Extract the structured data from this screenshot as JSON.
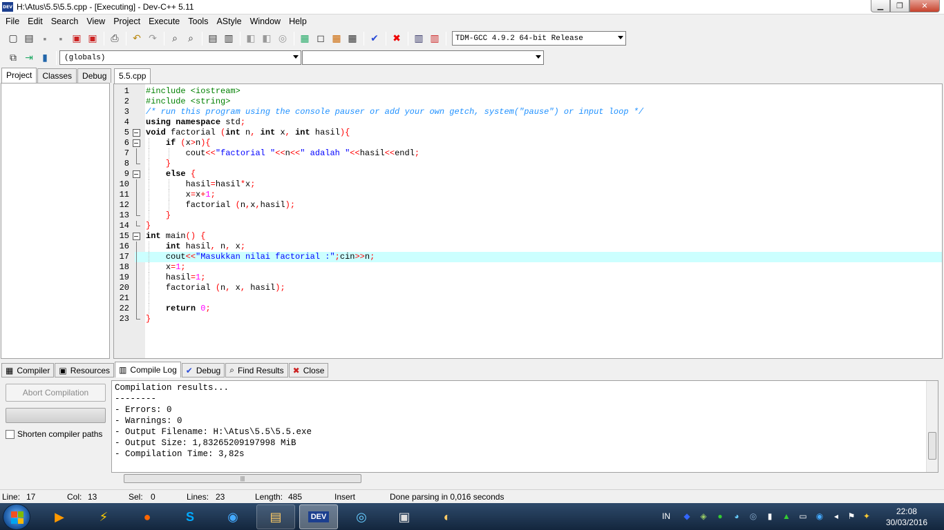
{
  "window": {
    "title": "H:\\Atus\\5.5\\5.5.cpp - [Executing] - Dev-C++ 5.11",
    "app_icon_label": "DEV",
    "controls": {
      "minimize": "▁",
      "maximize": "❐",
      "close": "✕"
    }
  },
  "menu": [
    "File",
    "Edit",
    "Search",
    "View",
    "Project",
    "Execute",
    "Tools",
    "AStyle",
    "Window",
    "Help"
  ],
  "toolbar": {
    "compiler": "TDM-GCC 4.9.2 64-bit Release",
    "scope": "(globals)",
    "function": ""
  },
  "left_tabs": [
    "Project",
    "Classes",
    "Debug"
  ],
  "editor": {
    "tab": "5.5.cpp",
    "current_line": 17,
    "lines": [
      {
        "n": "1",
        "fold": "none",
        "indent": 0,
        "tokens": [
          [
            "pre",
            "#include <iostream>"
          ]
        ]
      },
      {
        "n": "2",
        "fold": "none",
        "indent": 0,
        "tokens": [
          [
            "pre",
            "#include <string>"
          ]
        ]
      },
      {
        "n": "3",
        "fold": "none",
        "indent": 0,
        "tokens": [
          [
            "com",
            "/* run this program using the console pauser or add your own getch, system(\"pause\") or input loop */"
          ]
        ]
      },
      {
        "n": "4",
        "fold": "none",
        "indent": 0,
        "tokens": [
          [
            "kw",
            "using namespace"
          ],
          [
            "id",
            " std"
          ],
          [
            "sym",
            ";"
          ]
        ]
      },
      {
        "n": "5",
        "fold": "box",
        "indent": 0,
        "tokens": [
          [
            "kw",
            "void"
          ],
          [
            "id",
            " factorial "
          ],
          [
            "sym",
            "("
          ],
          [
            "kw",
            "int"
          ],
          [
            "id",
            " n"
          ],
          [
            "sym",
            ", "
          ],
          [
            "kw",
            "int"
          ],
          [
            "id",
            " x"
          ],
          [
            "sym",
            ", "
          ],
          [
            "kw",
            "int"
          ],
          [
            "id",
            " hasil"
          ],
          [
            "sym",
            "){"
          ]
        ]
      },
      {
        "n": "6",
        "fold": "box",
        "indent": 1,
        "tokens": [
          [
            "kw",
            "if"
          ],
          [
            "id",
            " "
          ],
          [
            "sym",
            "("
          ],
          [
            "id",
            "x"
          ],
          [
            "sym",
            ">"
          ],
          [
            "id",
            "n"
          ],
          [
            "sym",
            "){"
          ]
        ]
      },
      {
        "n": "7",
        "fold": "line",
        "indent": 2,
        "tokens": [
          [
            "id",
            "cout"
          ],
          [
            "sym",
            "<<"
          ],
          [
            "str",
            "\"factorial \""
          ],
          [
            "sym",
            "<<"
          ],
          [
            "id",
            "n"
          ],
          [
            "sym",
            "<<"
          ],
          [
            "str",
            "\" adalah \""
          ],
          [
            "sym",
            "<<"
          ],
          [
            "id",
            "hasil"
          ],
          [
            "sym",
            "<<"
          ],
          [
            "id",
            "endl"
          ],
          [
            "sym",
            ";"
          ]
        ]
      },
      {
        "n": "8",
        "fold": "end",
        "indent": 1,
        "tokens": [
          [
            "sym",
            "}"
          ]
        ]
      },
      {
        "n": "9",
        "fold": "box",
        "indent": 1,
        "tokens": [
          [
            "kw",
            "else"
          ],
          [
            "id",
            " "
          ],
          [
            "sym",
            "{"
          ]
        ]
      },
      {
        "n": "10",
        "fold": "line",
        "indent": 2,
        "tokens": [
          [
            "id",
            "hasil"
          ],
          [
            "sym",
            "="
          ],
          [
            "id",
            "hasil"
          ],
          [
            "sym",
            "*"
          ],
          [
            "id",
            "x"
          ],
          [
            "sym",
            ";"
          ]
        ]
      },
      {
        "n": "11",
        "fold": "line",
        "indent": 2,
        "tokens": [
          [
            "id",
            "x"
          ],
          [
            "sym",
            "="
          ],
          [
            "id",
            "x"
          ],
          [
            "sym",
            "+"
          ],
          [
            "num",
            "1"
          ],
          [
            "sym",
            ";"
          ]
        ]
      },
      {
        "n": "12",
        "fold": "line",
        "indent": 2,
        "tokens": [
          [
            "id",
            "factorial "
          ],
          [
            "sym",
            "("
          ],
          [
            "id",
            "n"
          ],
          [
            "sym",
            ","
          ],
          [
            "id",
            "x"
          ],
          [
            "sym",
            ","
          ],
          [
            "id",
            "hasil"
          ],
          [
            "sym",
            ");"
          ]
        ]
      },
      {
        "n": "13",
        "fold": "end",
        "indent": 1,
        "tokens": [
          [
            "sym",
            "}"
          ]
        ]
      },
      {
        "n": "14",
        "fold": "end",
        "indent": 0,
        "tokens": [
          [
            "sym",
            "}"
          ]
        ]
      },
      {
        "n": "15",
        "fold": "box",
        "indent": 0,
        "tokens": [
          [
            "kw",
            "int"
          ],
          [
            "id",
            " main"
          ],
          [
            "sym",
            "() {"
          ]
        ]
      },
      {
        "n": "16",
        "fold": "line",
        "indent": 1,
        "tokens": [
          [
            "kw",
            "int"
          ],
          [
            "id",
            " hasil"
          ],
          [
            "sym",
            ", "
          ],
          [
            "id",
            "n"
          ],
          [
            "sym",
            ", "
          ],
          [
            "id",
            "x"
          ],
          [
            "sym",
            ";"
          ]
        ]
      },
      {
        "n": "17",
        "fold": "line",
        "indent": 1,
        "tokens": [
          [
            "id",
            "cout"
          ],
          [
            "sym",
            "<<"
          ],
          [
            "str",
            "\"Masukkan nilai factorial :\""
          ],
          [
            "sym",
            ";"
          ],
          [
            "id",
            "cin"
          ],
          [
            "sym",
            ">>"
          ],
          [
            "id",
            "n"
          ],
          [
            "sym",
            ";"
          ]
        ]
      },
      {
        "n": "18",
        "fold": "line",
        "indent": 1,
        "tokens": [
          [
            "id",
            "x"
          ],
          [
            "sym",
            "="
          ],
          [
            "num",
            "1"
          ],
          [
            "sym",
            ";"
          ]
        ]
      },
      {
        "n": "19",
        "fold": "line",
        "indent": 1,
        "tokens": [
          [
            "id",
            "hasil"
          ],
          [
            "sym",
            "="
          ],
          [
            "num",
            "1"
          ],
          [
            "sym",
            ";"
          ]
        ]
      },
      {
        "n": "20",
        "fold": "line",
        "indent": 1,
        "tokens": [
          [
            "id",
            "factorial "
          ],
          [
            "sym",
            "("
          ],
          [
            "id",
            "n"
          ],
          [
            "sym",
            ", "
          ],
          [
            "id",
            "x"
          ],
          [
            "sym",
            ", "
          ],
          [
            "id",
            "hasil"
          ],
          [
            "sym",
            ");"
          ]
        ]
      },
      {
        "n": "21",
        "fold": "line",
        "indent": 1,
        "tokens": []
      },
      {
        "n": "22",
        "fold": "line",
        "indent": 1,
        "tokens": [
          [
            "kw",
            "return"
          ],
          [
            "id",
            " "
          ],
          [
            "num",
            "0"
          ],
          [
            "sym",
            ";"
          ]
        ]
      },
      {
        "n": "23",
        "fold": "end",
        "indent": 0,
        "tokens": [
          [
            "sym",
            "}"
          ]
        ]
      }
    ]
  },
  "bottom_tabs": [
    {
      "label": "Compiler",
      "icon": "grid-icon",
      "glyph": "▦"
    },
    {
      "label": "Resources",
      "icon": "resources-icon",
      "glyph": "▣"
    },
    {
      "label": "Compile Log",
      "icon": "chart-icon",
      "glyph": "▥"
    },
    {
      "label": "Debug",
      "icon": "check-icon",
      "glyph": "✔"
    },
    {
      "label": "Find Results",
      "icon": "find-icon",
      "glyph": "⌕"
    },
    {
      "label": "Close",
      "icon": "close-icon",
      "glyph": "✖"
    }
  ],
  "compile_panel": {
    "abort_label": "Abort Compilation",
    "shorten_label": "Shorten compiler paths",
    "log": [
      "Compilation results...",
      "--------",
      "- Errors: 0",
      "- Warnings: 0",
      "- Output Filename: H:\\Atus\\5.5\\5.5.exe",
      "- Output Size: 1,83265209197998 MiB",
      "- Compilation Time: 3,82s"
    ],
    "hscroll_grip": "|||"
  },
  "status": {
    "line_label": "Line:",
    "line_value": "17",
    "col_label": "Col:",
    "col_value": "13",
    "sel_label": "Sel:",
    "sel_value": "0",
    "lines_label": "Lines:",
    "lines_value": "23",
    "length_label": "Length:",
    "length_value": "485",
    "mode": "Insert",
    "message": "Done parsing in 0,016 seconds"
  },
  "taskbar": {
    "lang": "IN",
    "time": "22:08",
    "date": "30/03/2016",
    "dev_label": "DEV"
  }
}
